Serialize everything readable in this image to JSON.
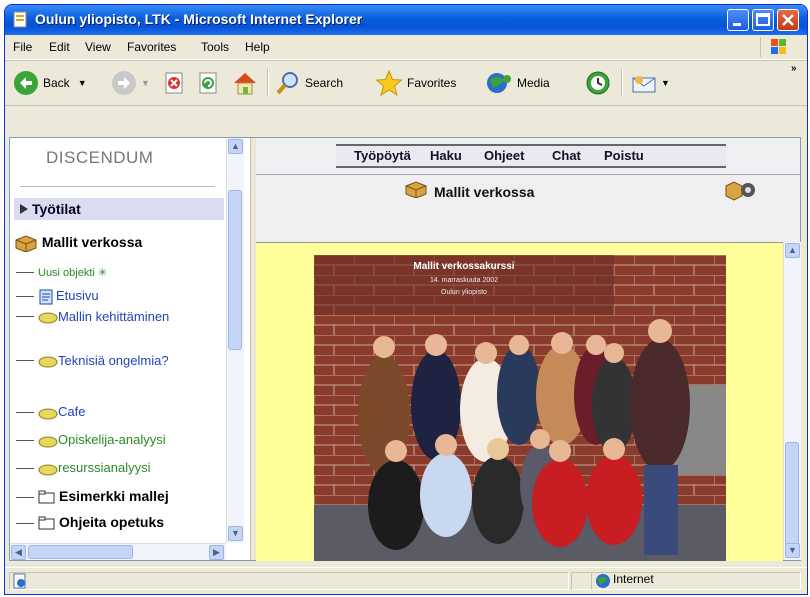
{
  "window": {
    "title": "Oulun yliopisto, LTK - Microsoft Internet Explorer"
  },
  "menu": [
    "File",
    "Edit",
    "View",
    "Favorites",
    "Tools",
    "Help"
  ],
  "toolbar": {
    "back_label": "Back",
    "search_label": "Search",
    "favorites_label": "Favorites",
    "media_label": "Media"
  },
  "left_frame": {
    "brand": "DISCENDUM",
    "workspace": "Työtilat",
    "root": "Mallit verkossa",
    "items": [
      {
        "label": "Uusi objekti",
        "color": "green"
      },
      {
        "label": "Etusivu",
        "color": "blue"
      },
      {
        "label": "Mallin kehittäminen",
        "color": "blue"
      },
      {
        "label": "Teknisiä ongelmia?",
        "color": "blue"
      },
      {
        "label": "Cafe",
        "color": "blue"
      },
      {
        "label": "Opiskelija-analyysi",
        "color": "green"
      },
      {
        "label": "resurssianalyysi",
        "color": "green"
      },
      {
        "label": "Esimerkki mallej",
        "color": "black"
      },
      {
        "label": "Ohjeita opetuks",
        "color": "black"
      }
    ]
  },
  "right_frame": {
    "nav": [
      "Työpöytä",
      "Haku",
      "Ohjeet",
      "Chat",
      "Poistu"
    ],
    "page_title": "Mallit verkossa",
    "photo_caption": "Mallit verkossakurssi",
    "photo_date": "14. marraskuuta 2002",
    "photo_place": "Oulun yliopisto"
  },
  "status": {
    "zone": "Internet"
  }
}
